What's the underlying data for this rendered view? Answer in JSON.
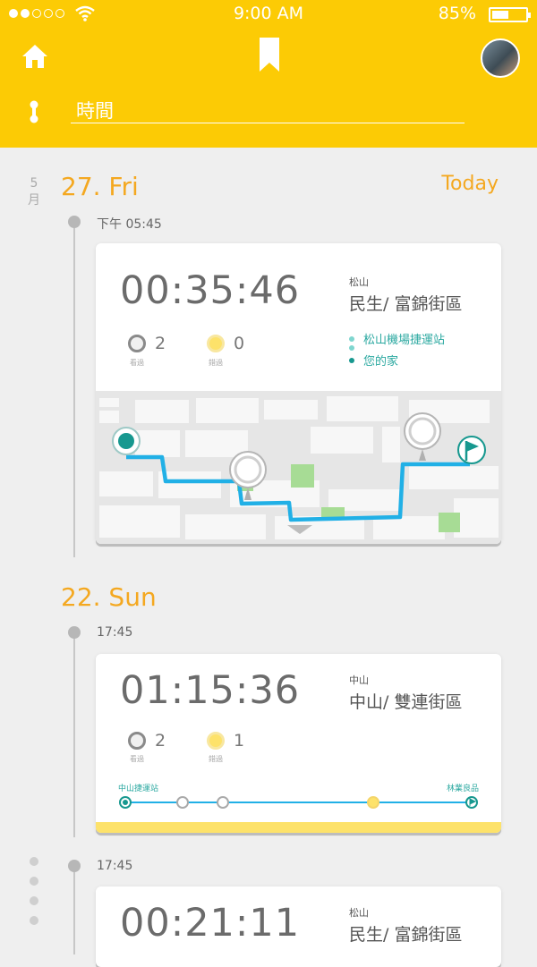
{
  "status": {
    "time": "9:00  AM",
    "battery": "85%"
  },
  "search": {
    "text": "時間"
  },
  "date_month": [
    "5",
    "月"
  ],
  "today_label": "Today",
  "days": [
    {
      "label": "27. Fri"
    },
    {
      "label": "22. Sun"
    }
  ],
  "trips": [
    {
      "time": "下午 05:45",
      "duration": "00:35:46",
      "district": "松山",
      "place": "民生/ 富錦街區",
      "seen_count": "2",
      "seen_label": "看過",
      "missed_count": "0",
      "missed_label": "錯過",
      "route": [
        "松山機場捷運站",
        "您的家"
      ]
    },
    {
      "time": "17:45",
      "duration": "01:15:36",
      "district": "中山",
      "place": "中山/ 雙連街區",
      "seen_count": "2",
      "seen_label": "看過",
      "missed_count": "1",
      "missed_label": "錯過",
      "start": "中山捷運站",
      "end": "林業良品"
    },
    {
      "time": "17:45",
      "duration": "00:21:11",
      "district": "松山",
      "place": "民生/ 富錦街區"
    }
  ],
  "colors": {
    "accent": "#fccb05",
    "route": "#21b0e6",
    "teal": "#17988f",
    "date": "#f4a820"
  }
}
